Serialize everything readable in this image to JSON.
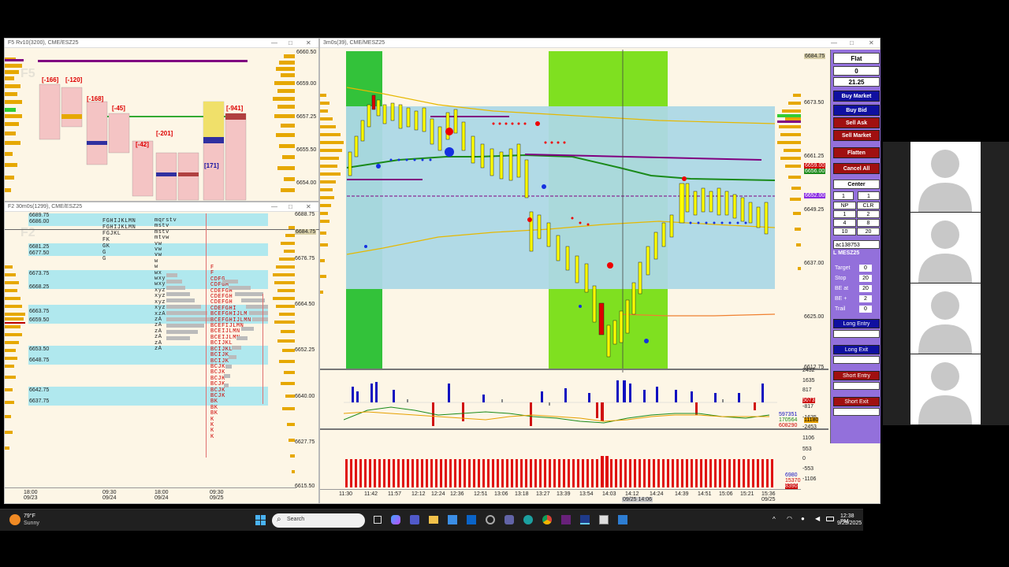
{
  "windows": {
    "w1": {
      "title": "F5 Rv10(3200), CME/ESZ25",
      "watermark": "F5"
    },
    "w2": {
      "title": "F2 30m0s(1299), CME/ESZ25",
      "watermark": "F2"
    },
    "main": {
      "title": "3m0s(39), CME/MESZ25"
    }
  },
  "w1": {
    "prices": [
      "6660.50",
      "6659.00",
      "6657.25",
      "6655.50",
      "6654.00"
    ],
    "deltas": [
      "[-166]",
      "[-120]",
      "[-168]",
      "[-45]",
      "[-42]",
      "[-201]",
      "[171]",
      "[-941]"
    ]
  },
  "w2": {
    "prices": [
      "6689.75",
      "6686.00",
      "6681.25",
      "6677.50",
      "6673.75",
      "6668.25",
      "6663.75",
      "6659.50",
      "6653.50",
      "6648.75",
      "6642.75",
      "6637.75"
    ],
    "scale": [
      "6688.75",
      "6676.75",
      "6664.50",
      "6652.25",
      "6640.00",
      "6627.75",
      "6615.50"
    ],
    "scale_hl": "6684.75",
    "time": [
      "18:00",
      "09/23",
      "09:30",
      "09/24",
      "18:00",
      "09/24",
      "09:30",
      "09/25"
    ]
  },
  "main": {
    "scale": [
      "6684.75",
      "6673.50",
      "6661.25",
      "6659.00",
      "6656.00",
      "6652.00",
      "6649.25",
      "6637.00",
      "6625.00",
      "6612.75"
    ],
    "vol_scale": [
      "2432",
      "1635",
      "817",
      "5073",
      "-817",
      "-1635",
      "-2453"
    ],
    "vol_vals": [
      "597351",
      "170564",
      "11180",
      "608290"
    ],
    "bot_scale": [
      "1106",
      "553",
      "0",
      "-553",
      "-1106"
    ],
    "bot_vals": [
      "6980",
      "15370",
      "8390"
    ],
    "times": [
      "11:30",
      "11:42",
      "11:57",
      "12:12",
      "12:24",
      "12:36",
      "12:51",
      "13:06",
      "13:18",
      "13:27",
      "13:39",
      "13:54",
      "14:03",
      "14:12",
      "14:24",
      "14:39",
      "14:51",
      "15:06",
      "15:21",
      "15:36"
    ],
    "cursor_time": "09/25 14:06",
    "last_date": "09/25"
  },
  "dom": {
    "status": "Flat",
    "position": "0",
    "pnl": "21.25",
    "buy_market": "Buy Market",
    "buy_bid": "Buy Bid",
    "sell_ask": "Sell Ask",
    "sell_market": "Sell Market",
    "flatten": "Flatten",
    "cancel_all": "Cancel All",
    "center": "Center",
    "qty": "1",
    "qty2": "1",
    "np": "NP",
    "clr": "CLR",
    "q": [
      "1",
      "2",
      "4",
      "8",
      "10",
      "20"
    ],
    "account": "ac138753",
    "symbol": "L MESZ25",
    "target_lbl": "Target",
    "target": "0",
    "stop_lbl": "Stop",
    "stop": "20",
    "be_at_lbl": "BE at",
    "be_at": "20",
    "be_plus_lbl": "BE +",
    "be_plus": "2",
    "trail_lbl": "Trail",
    "trail": "0",
    "long_entry": "Long Entry",
    "long_exit": "Long Exit",
    "short_entry": "Short Entry",
    "short_exit": "Short Exit"
  },
  "taskbar": {
    "temp": "79°F",
    "weather": "Sunny",
    "search_placeholder": "Search",
    "time": "12:38 PM",
    "date": "9/25/2025"
  },
  "colors": {
    "accent": "#9370db",
    "buy": "#1010a0",
    "sell": "#a01010",
    "green_zone": "#33cc33",
    "value_area": "#add8e6"
  }
}
